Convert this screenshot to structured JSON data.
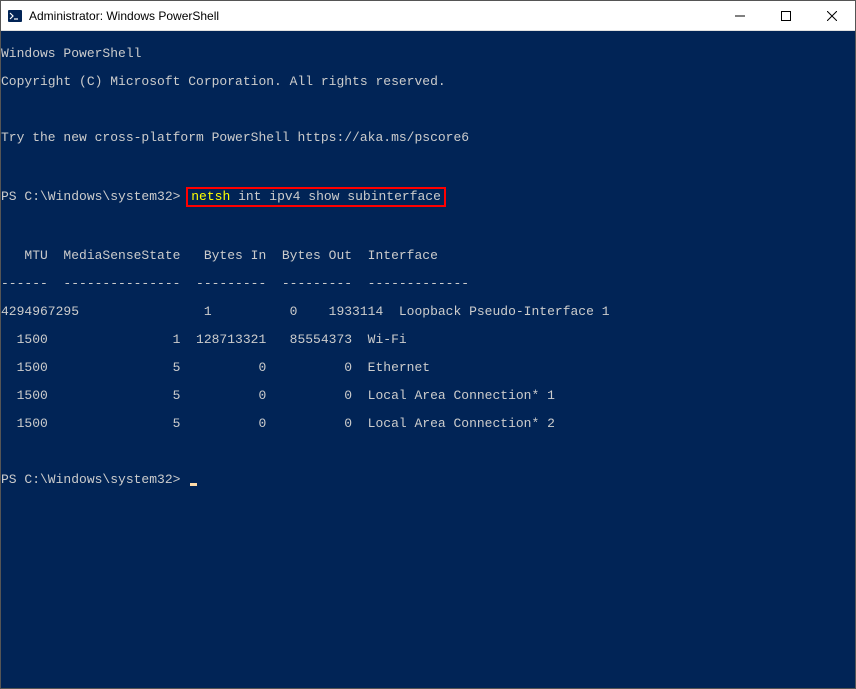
{
  "window": {
    "title": "Administrator: Windows PowerShell"
  },
  "terminal": {
    "banner_line1": "Windows PowerShell",
    "banner_line2": "Copyright (C) Microsoft Corporation. All rights reserved.",
    "banner_line3": "Try the new cross-platform PowerShell https://aka.ms/pscore6",
    "prompt1_path": "PS C:\\Windows\\system32>",
    "command_highlighted": {
      "cmd_keyword": "netsh",
      "cmd_rest": " int ipv4 show subinterface"
    },
    "table": {
      "header": "   MTU  MediaSenseState   Bytes In  Bytes Out  Interface",
      "divider": "------  ---------------  ---------  ---------  -------------",
      "rows": [
        "4294967295                1          0    1933114  Loopback Pseudo-Interface 1",
        "  1500                1  128713321   85554373  Wi-Fi",
        "  1500                5          0          0  Ethernet",
        "  1500                5          0          0  Local Area Connection* 1",
        "  1500                5          0          0  Local Area Connection* 2"
      ]
    },
    "prompt2_path": "PS C:\\Windows\\system32>"
  }
}
